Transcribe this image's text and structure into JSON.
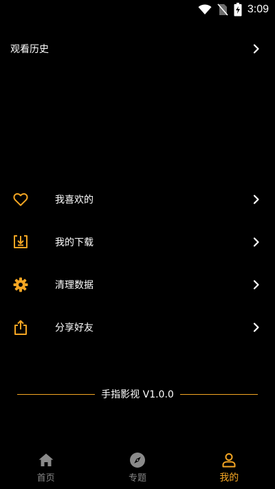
{
  "status_bar": {
    "time": "3:09",
    "icons": [
      "wifi-icon",
      "no-sim-icon",
      "battery-charging-icon"
    ]
  },
  "history": {
    "label": "观看历史",
    "icon": "chevron-right-icon"
  },
  "menu": {
    "items": [
      {
        "label": "我喜欢的",
        "icon": "heart-icon"
      },
      {
        "label": "我的下载",
        "icon": "download-icon"
      },
      {
        "label": "清理数据",
        "icon": "gear-icon"
      },
      {
        "label": "分享好友",
        "icon": "share-icon"
      }
    ]
  },
  "version": {
    "text": "手指影视 V1.0.0"
  },
  "bottom_nav": {
    "items": [
      {
        "label": "首页",
        "icon": "home-icon",
        "active": false
      },
      {
        "label": "专题",
        "icon": "compass-icon",
        "active": false
      },
      {
        "label": "我的",
        "icon": "user-icon",
        "active": true
      }
    ]
  },
  "colors": {
    "background": "#000000",
    "accent": "#f5a623",
    "inactive": "#8a8a8a",
    "text": "#ffffff"
  }
}
